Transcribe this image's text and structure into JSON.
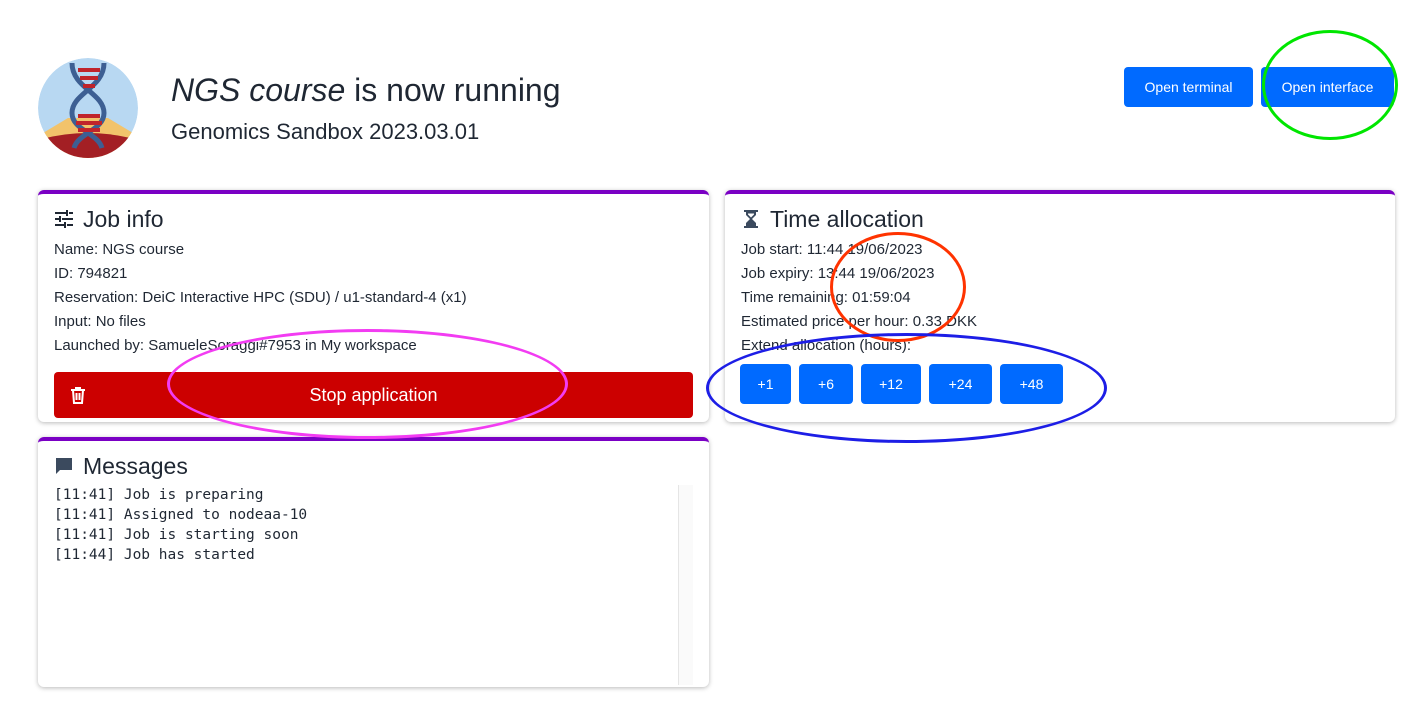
{
  "header": {
    "app_name": "NGS course",
    "status_suffix": " is now running",
    "subtitle": "Genomics Sandbox 2023.03.01",
    "avatar_icon": "dna-logo-icon"
  },
  "actions": {
    "open_terminal": "Open terminal",
    "open_interface": "Open interface"
  },
  "job_info": {
    "title": "Job info",
    "icon": "sliders-icon",
    "lines": [
      "Name: NGS course",
      "ID: 794821",
      "Reservation: DeiC Interactive HPC (SDU) / u1-standard-4 (x1)",
      "Input: No files",
      "Launched by: SamueleSoraggi#7953 in My workspace"
    ],
    "stop_label": "Stop application",
    "stop_icon": "trash-icon"
  },
  "time_allocation": {
    "title": "Time allocation",
    "icon": "hourglass-icon",
    "lines": [
      "Job start: 11:44 19/06/2023",
      "Job expiry: 13:44 19/06/2023",
      "Time remaining: 01:59:04",
      "Estimated price per hour: 0.33 DKK",
      "Extend allocation (hours):"
    ],
    "extend_buttons": [
      "+1",
      "+6",
      "+12",
      "+24",
      "+48"
    ]
  },
  "messages": {
    "title": "Messages",
    "icon": "chat-icon",
    "lines": [
      "[11:41] Job is preparing",
      "[11:41] Assigned to nodeaa-10",
      "[11:41] Job is starting soon",
      "[11:44] Job has started"
    ]
  },
  "colors": {
    "accent_purple": "#7a00c4",
    "primary_blue": "#006aff",
    "danger_red": "#cc0000",
    "annotation_green": "#00e600",
    "annotation_red": "#ff3300",
    "annotation_blue": "#1d1ee6",
    "annotation_pink": "#f23cf2"
  }
}
